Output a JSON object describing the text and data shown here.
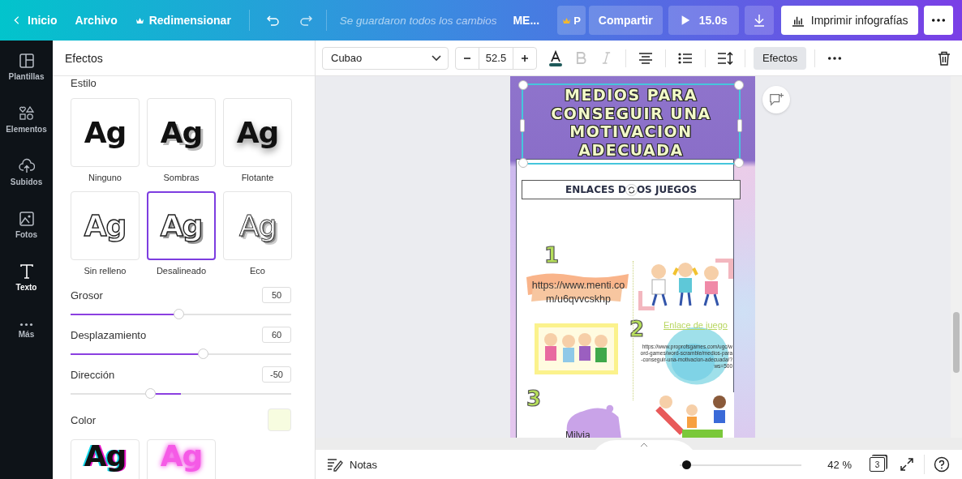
{
  "topbar": {
    "back": "Inicio",
    "menu": [
      "Archivo",
      "Redimensionar"
    ],
    "save_status": "Se guardaron todos los cambios",
    "doc_title": "ME...",
    "pro_badge": "P",
    "share": "Compartir",
    "play": "15.0s",
    "print": "Imprimir infografías"
  },
  "sidebar": {
    "items": [
      {
        "label": "Plantillas",
        "kind": "templates",
        "selected": false
      },
      {
        "label": "Elementos",
        "kind": "elements",
        "selected": false
      },
      {
        "label": "Subidos",
        "kind": "uploads",
        "selected": false
      },
      {
        "label": "Fotos",
        "kind": "photos",
        "selected": false
      },
      {
        "label": "Texto",
        "kind": "text",
        "selected": true
      },
      {
        "label": "Más",
        "kind": "more",
        "selected": false
      }
    ]
  },
  "panel": {
    "title": "Efectos",
    "section": "Estilo",
    "styles": [
      {
        "preview": "Ag",
        "label": "Ninguno",
        "kind": "none",
        "selected": false
      },
      {
        "preview": "Ag",
        "label": "Sombras",
        "kind": "shadow",
        "selected": false
      },
      {
        "preview": "Ag",
        "label": "Flotante",
        "kind": "lift",
        "selected": false
      },
      {
        "preview": "Ag",
        "label": "Sin relleno",
        "kind": "hollow",
        "selected": false
      },
      {
        "preview": "Ag",
        "label": "Desalineado",
        "kind": "splice",
        "selected": true
      },
      {
        "preview": "Ag",
        "label": "Eco",
        "kind": "echo",
        "selected": false
      }
    ],
    "sliders": [
      {
        "label": "Grosor",
        "value": "50",
        "kind": "normal",
        "level": 0.49
      },
      {
        "label": "Desplazamiento",
        "value": "60",
        "kind": "normal",
        "level": 0.6
      },
      {
        "label": "Dirección",
        "value": "-50",
        "kind": "centered",
        "level": 0.36
      }
    ],
    "color": {
      "label": "Color",
      "color": "#f7fce0"
    },
    "more_styles": [
      {
        "preview": "Ag",
        "kind": "glitch",
        "selected": false
      },
      {
        "preview": "Ag",
        "kind": "neon",
        "selected": false
      }
    ]
  },
  "toolbar": {
    "font": "Cubao",
    "size": "52.5",
    "bold_disabled": true,
    "italic_disabled": true,
    "effects": {
      "label": "Efectos",
      "selected": true
    }
  },
  "design": {
    "title_lines": [
      "MEDIOS PARA",
      "CONSEGUIR UNA",
      "MOTIVACION",
      "ADECUADA"
    ],
    "subtitle_parts": [
      "ENLACES D",
      "OS JUEGOS"
    ],
    "numbers": [
      "1",
      "2",
      "3"
    ],
    "link_1": "https://www.menti.com/u6qvvcskhp",
    "link_2_title": "Enlace de juego",
    "link_2_url": "https://www.proprofsgames.com/ugc/word-games/word-scramble/medios-para-conseguir-una-motivacion-adecuada/?ws=500",
    "name": "Milvia"
  },
  "bottombar": {
    "notes": "Notas",
    "zoom": {
      "level": 0.05
    },
    "zoom_label": "42 %",
    "pages": "3"
  }
}
